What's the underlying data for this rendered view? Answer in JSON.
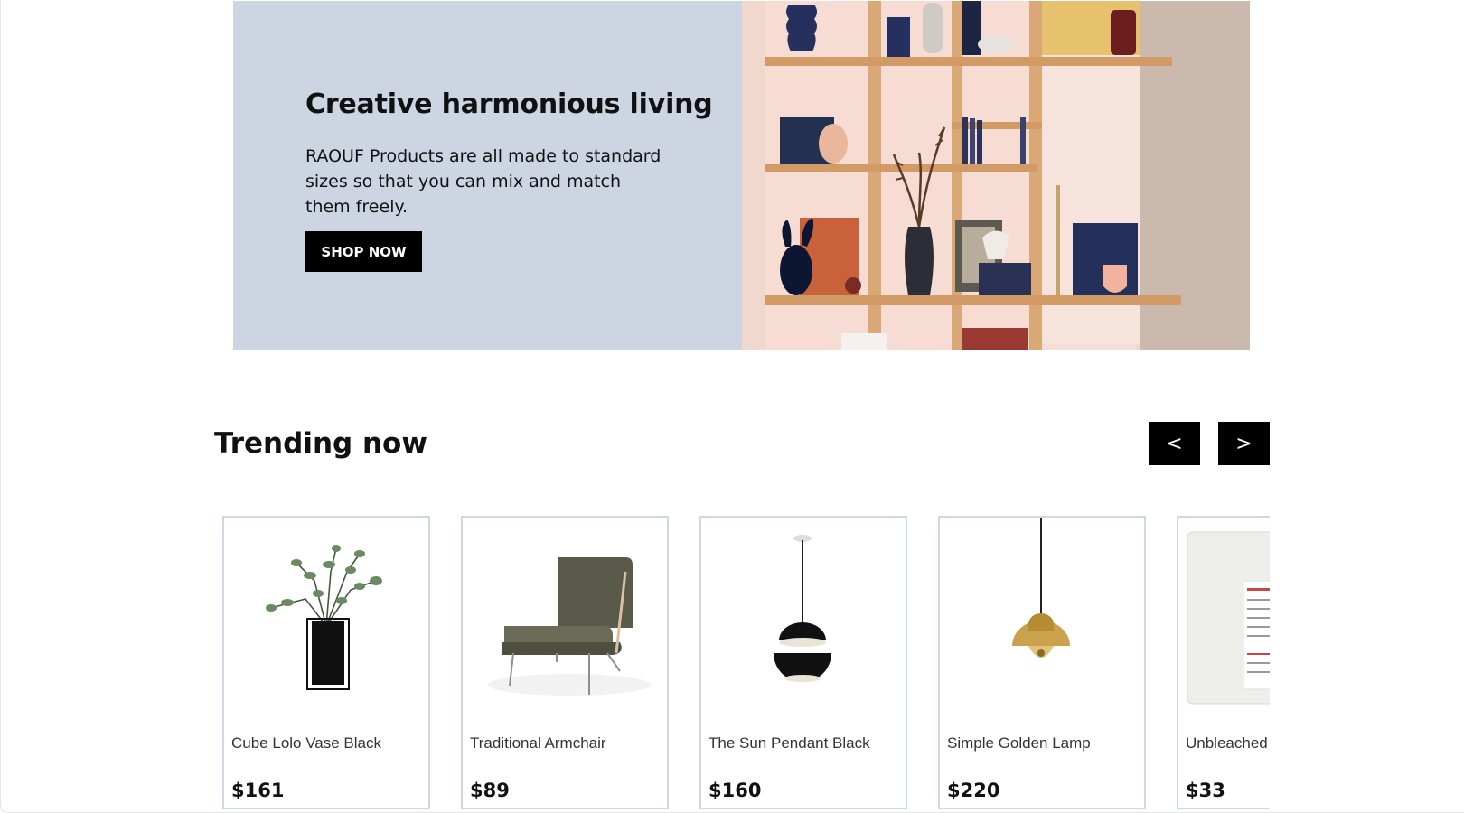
{
  "hero": {
    "title": "Creative harmonious living",
    "text": "RAOUF Products are all made to standard sizes so that you can mix and match them freely.",
    "button_label": "SHOP NOW",
    "bg_color": "#ccd5e1"
  },
  "trending": {
    "title": "Trending now",
    "prev_label": "<",
    "next_label": ">",
    "products": [
      {
        "name": "Cube Lolo Vase Black",
        "price": "$161",
        "icon": "vase-plant-image"
      },
      {
        "name": "Traditional Armchair",
        "price": "$89",
        "icon": "armchair-image"
      },
      {
        "name": "The Sun Pendant Black",
        "price": "$160",
        "icon": "pendant-lamp-image"
      },
      {
        "name": "Simple Golden Lamp",
        "price": "$220",
        "icon": "golden-lamp-image"
      },
      {
        "name": "Unbleached",
        "price": "$33",
        "icon": "cotton-pads-image"
      }
    ]
  },
  "colors": {
    "accent": "#000000",
    "card_border": "#cdd8e4"
  }
}
